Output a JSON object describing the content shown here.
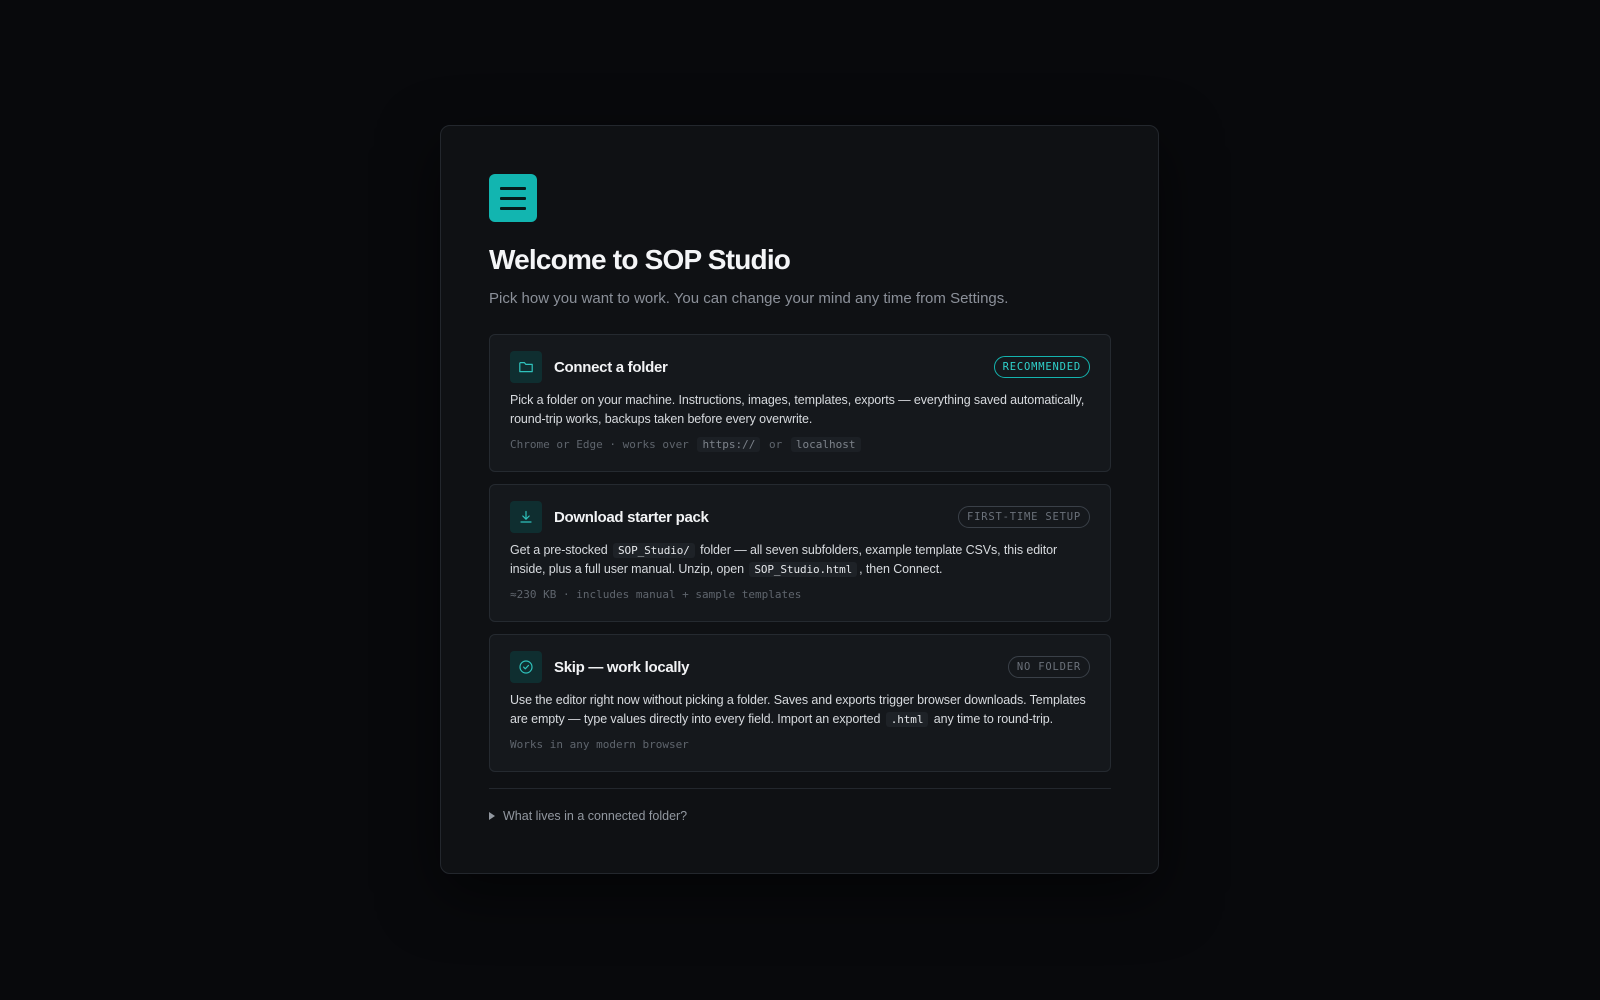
{
  "app": {
    "title": "Welcome to SOP Studio",
    "subtitle": "Pick how you want to work. You can change your mind any time from Settings."
  },
  "colors": {
    "accent": "#12b5b0",
    "background": "#08090c",
    "panel": "#0f1114",
    "card": "#15181c"
  },
  "options": [
    {
      "icon": "folder-icon",
      "title": "Connect a folder",
      "badge": "RECOMMENDED",
      "desc": [
        "Pick a folder on your machine. Instructions, images, templates, exports — everything saved automatically, round-trip works, backups taken before every overwrite."
      ],
      "meta": [
        "Chrome or Edge · works over",
        "https://",
        "or",
        "localhost"
      ]
    },
    {
      "icon": "download-icon",
      "title": "Download starter pack",
      "badge": "FIRST-TIME SETUP",
      "desc": [
        "Get a pre-stocked",
        "SOP_Studio/",
        "folder — all seven subfolders, example template CSVs, this editor inside, plus a full user manual. Unzip, open",
        "SOP_Studio.html",
        ", then Connect."
      ],
      "meta": [
        "≈230 KB · includes manual + sample templates"
      ]
    },
    {
      "icon": "check-circle-icon",
      "title": "Skip — work locally",
      "badge": "NO FOLDER",
      "desc": [
        "Use the editor right now without picking a folder. Saves and exports trigger browser downloads. Templates are empty — type values directly into every field. Import an exported",
        ".html",
        "any time to round-trip."
      ],
      "meta": [
        "Works in any modern browser"
      ]
    }
  ],
  "disclosure": {
    "label": "What lives in a connected folder?"
  }
}
